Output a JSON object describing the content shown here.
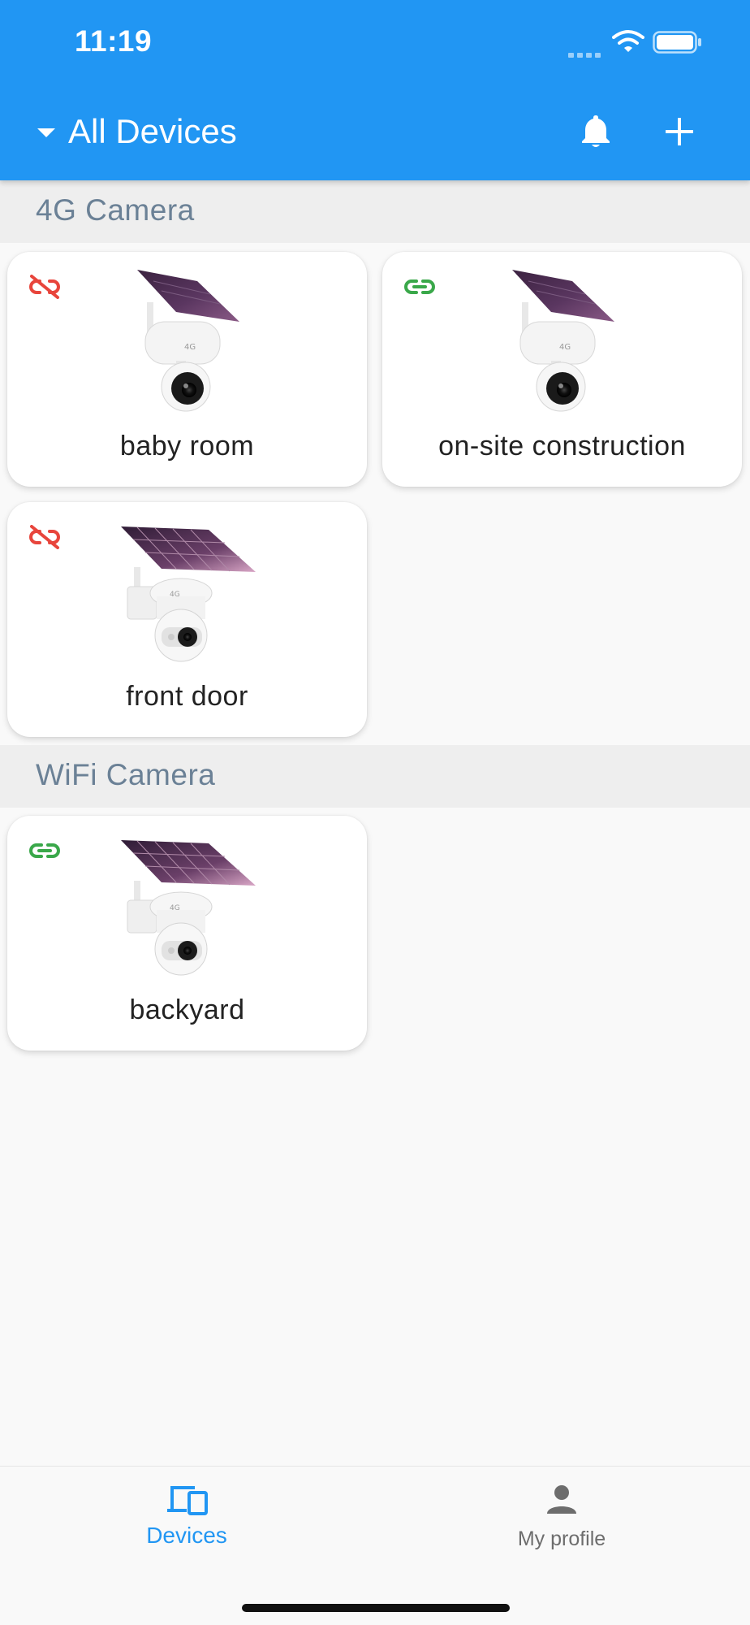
{
  "status_bar": {
    "time": "11:19"
  },
  "header": {
    "title": "All Devices",
    "icons": [
      "caret-down-icon",
      "bell-icon",
      "plus-icon"
    ]
  },
  "sections": [
    {
      "title": "4G Camera",
      "devices": [
        {
          "name": "baby room",
          "status": "disconnected",
          "status_icon": "link-off-icon",
          "camera_style": "4g-solar-camera"
        },
        {
          "name": "on-site construction",
          "status": "connected",
          "status_icon": "link-icon",
          "camera_style": "4g-solar-camera"
        },
        {
          "name": "front door",
          "status": "disconnected",
          "status_icon": "link-off-icon",
          "camera_style": "ptz-solar-camera"
        }
      ]
    },
    {
      "title": "WiFi Camera",
      "devices": [
        {
          "name": "backyard",
          "status": "connected",
          "status_icon": "link-icon",
          "camera_style": "ptz-solar-camera"
        }
      ]
    }
  ],
  "bottom_nav": {
    "items": [
      {
        "label": "Devices",
        "icon": "devices-icon",
        "active": true
      },
      {
        "label": "My profile",
        "icon": "person-icon",
        "active": false
      }
    ]
  },
  "colors": {
    "primary": "#2196f3",
    "connected": "#3aa84a",
    "disconnected": "#e8453c",
    "section_text": "#6b8196"
  }
}
